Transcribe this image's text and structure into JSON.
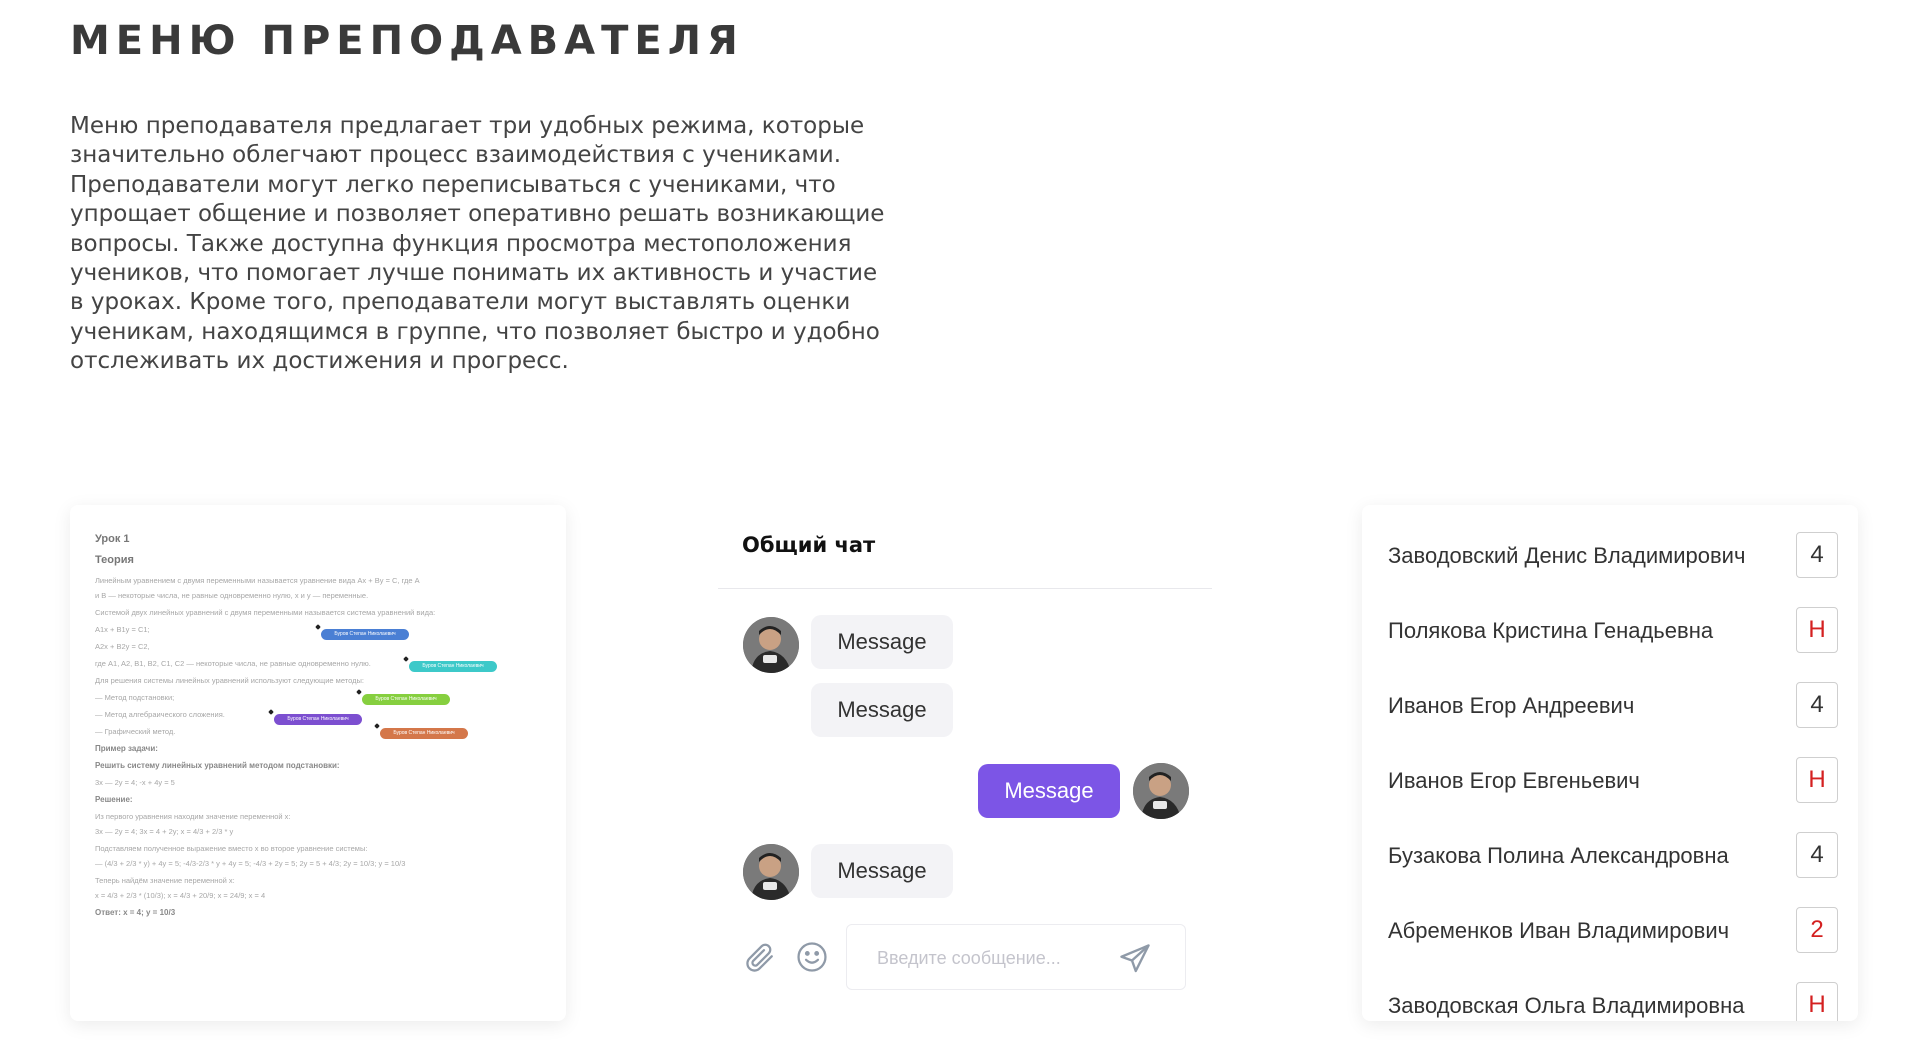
{
  "page": {
    "title": "МЕНЮ ПРЕПОДАВАТЕЛЯ",
    "intro": "Меню преподавателя предлагает три удобных режима, которые значительно облегчают процесс взаимодействия с учениками. Преподаватели могут легко переписываться с учениками, что упрощает общение и позволяет оперативно решать возникающие вопросы. Также доступна функция просмотра местоположения учеников, что помогает лучше понимать их активность и участие в уроках. Кроме того, преподаватели могут выставлять оценки ученикам, находящимся в группе, что позволяет быстро и удобно отслеживать их достижения и прогресс."
  },
  "lesson": {
    "title": "Урок 1",
    "section": "Теория",
    "lines": [
      "Линейным уравнением с двумя переменными называется уравнение вида Ax + By = C, где A",
      "и B — некоторые числа, не равные одновременно нулю, x и y — переменные.",
      "Системой двух линейных уравнений с двумя переменными называется система уравнений вида:",
      "A1x + B1y = C1;",
      "A2x + B2y = C2,",
      "где A1, A2, B1, B2, C1, C2 — некоторые числа, не равные одновременно нулю.",
      "Для решения системы линейных уравнений используют следующие методы:",
      "— Метод подстановки;",
      "— Метод алгебраического сложения.",
      "— Графический метод.",
      "Пример задачи:",
      "Решить систему линейных уравнений методом подстановки:",
      "3x — 2y = 4; -x + 4y = 5",
      "Решение:",
      "Из первого уравнения находим значение переменной x:",
      "3x — 2y = 4; 3x = 4 + 2y; x = 4/3 + 2/3 * y",
      "Подставляем полученное выражение вместо x во второе уравнение системы:",
      "— (4/3 + 2/3 * y) + 4y = 5; -4/3-2/3 * y + 4y = 5; -4/3 + 2y = 5; 2y = 5 + 4/3; 2y = 10/3; y = 10/3",
      "Теперь найдём значение переменной x:",
      "x = 4/3 + 2/3 * (10/3); x = 4/3 + 20/9; x = 24/9; x = 4",
      "Ответ:      x = 4; y = 10/3"
    ],
    "pills": [
      {
        "text": "Буров Степан Николаевич",
        "color": "#4a7fd4"
      },
      {
        "text": "Буров Степан Николаевич",
        "color": "#3dc9c9"
      },
      {
        "text": "Буров Степан Николаевич",
        "color": "#86cf3f"
      },
      {
        "text": "Буров Степан Николаевич",
        "color": "#7c4fd0"
      },
      {
        "text": "Буров Степан Николаевич",
        "color": "#d4774a"
      }
    ]
  },
  "chat": {
    "title": "Общий чат",
    "messages": [
      "Message",
      "Message",
      "Message",
      "Message"
    ],
    "input_placeholder": "Введите сообщение...",
    "accent": "#7c55e6"
  },
  "grades": {
    "rows": [
      {
        "name": "Заводовский Денис Владимирович",
        "mark": "4"
      },
      {
        "name": "Полякова Кристина Генадьевна",
        "mark": "Н"
      },
      {
        "name": "Иванов Егор Андреевич",
        "mark": "4"
      },
      {
        "name": "Иванов Егор Евгеньевич",
        "mark": "Н"
      },
      {
        "name": "Бузакова Полина Александровна",
        "mark": "4"
      },
      {
        "name": "Абременков Иван Владимирович",
        "mark": "2"
      },
      {
        "name": "Заводовская Ольга Владимировна",
        "mark": "Н"
      }
    ],
    "highlight_color": "#d42020"
  }
}
